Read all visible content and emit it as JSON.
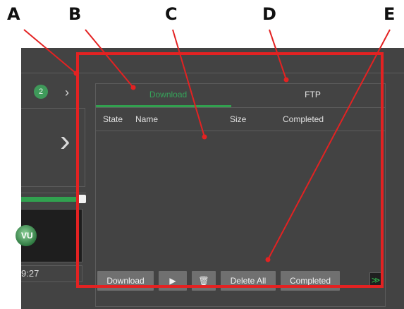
{
  "callouts": {
    "a": "A",
    "b": "B",
    "c": "C",
    "d": "D",
    "e": "E"
  },
  "left_panel": {
    "badge_count": "2",
    "chevron": "›",
    "large_chevron": "›",
    "time": "9:27"
  },
  "tabs": {
    "download": "Download",
    "ftp": "FTP"
  },
  "table": {
    "headers": {
      "state": "State",
      "name": "Name",
      "size": "Size",
      "completed": "Completed"
    }
  },
  "buttons": {
    "download": "Download",
    "play": "▶",
    "trash": "🗑",
    "delete_all": "Delete All",
    "completed": "Completed",
    "collapse": "≫"
  },
  "colors": {
    "accent": "#31a14f",
    "highlight": "#e32222",
    "panel": "#434343"
  }
}
